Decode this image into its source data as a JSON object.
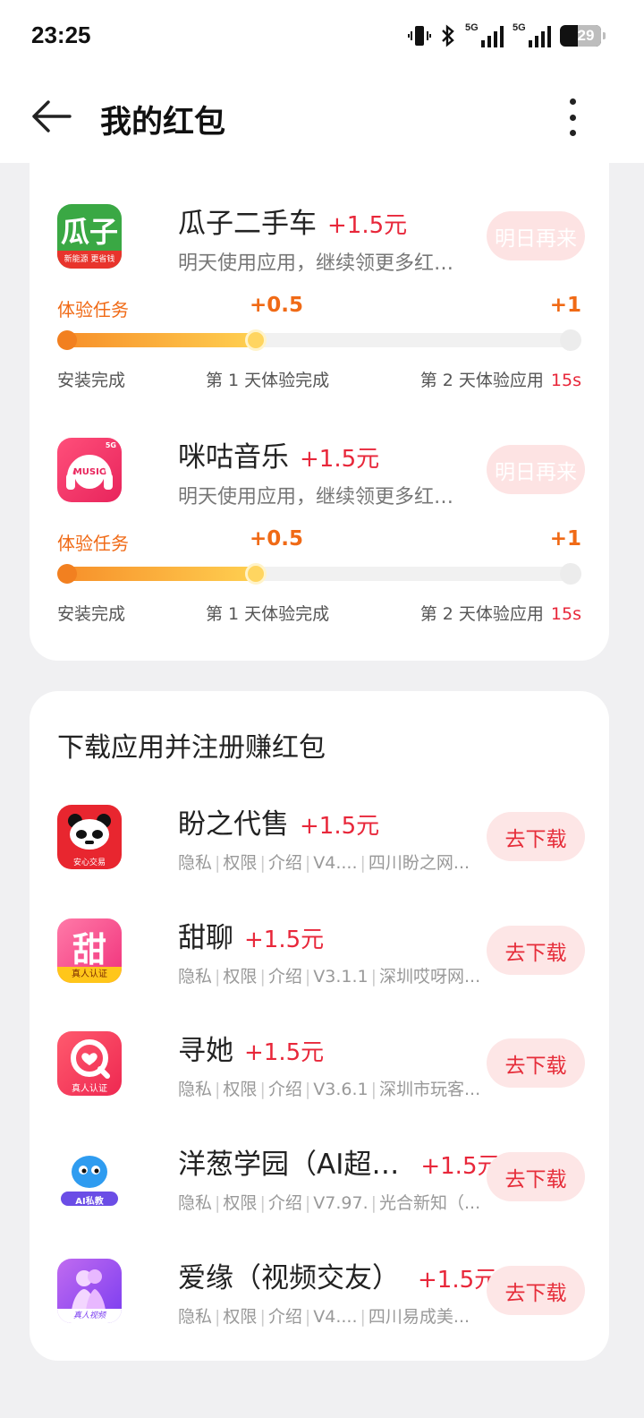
{
  "status": {
    "time": "23:25",
    "battery": "29",
    "net1": "5G",
    "net2": "5G"
  },
  "header": {
    "title": "我的红包"
  },
  "experience_apps": [
    {
      "name": "瓜子二手车",
      "reward": "+1.5元",
      "desc": "明天使用应用，继续领更多红…",
      "button": "明日再来",
      "task_label": "体验任务",
      "mid_reward": "+0.5",
      "end_reward": "+1",
      "steps": [
        "安装完成",
        "第 1 天体验完成",
        "第 2 天体验应用"
      ],
      "seconds": "15s",
      "icon_text": "瓜子",
      "icon_sub": "新能源 更省钱"
    },
    {
      "name": "咪咕音乐",
      "reward": "+1.5元",
      "desc": "明天使用应用，继续领更多红…",
      "button": "明日再来",
      "task_label": "体验任务",
      "mid_reward": "+0.5",
      "end_reward": "+1",
      "steps": [
        "安装完成",
        "第 1 天体验完成",
        "第 2 天体验应用"
      ],
      "seconds": "15s",
      "icon_text": "MUSIC",
      "icon_sub": "5G"
    }
  ],
  "download_section": {
    "title": "下载应用并注册赚红包",
    "apps": [
      {
        "name": "盼之代售",
        "reward": "+1.5元",
        "meta": [
          "隐私",
          "权限",
          "介绍",
          "V4....",
          "四川盼之网..."
        ],
        "button": "去下载",
        "icon_sub": "安心交易"
      },
      {
        "name": "甜聊",
        "reward": "+1.5元",
        "meta": [
          "隐私",
          "权限",
          "介绍",
          "V3.1.1",
          "深圳哎呀网..."
        ],
        "button": "去下载",
        "icon_text": "甜",
        "icon_sub": "真人认证"
      },
      {
        "name": "寻她",
        "reward": "+1.5元",
        "meta": [
          "隐私",
          "权限",
          "介绍",
          "V3.6.1",
          "深圳市玩客..."
        ],
        "button": "去下载",
        "icon_sub": "真人认证"
      },
      {
        "name": "洋葱学园（AI超…",
        "reward": "+1.5元",
        "meta": [
          "隐私",
          "权限",
          "介绍",
          "V7.97.",
          "光合新知（..."
        ],
        "button": "去下载",
        "icon_sub": "AI私教"
      },
      {
        "name": "爱缘（视频交友）",
        "reward": "+1.5元",
        "meta": [
          "隐私",
          "权限",
          "介绍",
          "V4....",
          "四川易成美..."
        ],
        "button": "去下载",
        "icon_sub": "真人视频"
      }
    ]
  }
}
